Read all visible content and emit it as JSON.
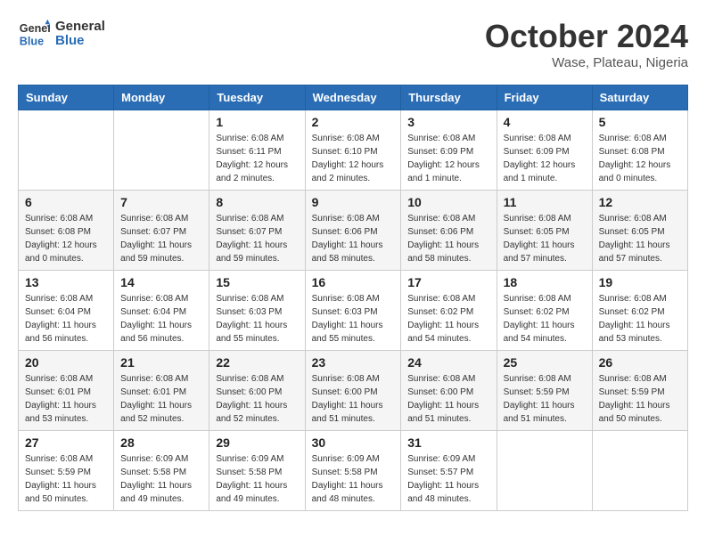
{
  "header": {
    "logo_line1": "General",
    "logo_line2": "Blue",
    "month": "October 2024",
    "location": "Wase, Plateau, Nigeria"
  },
  "weekdays": [
    "Sunday",
    "Monday",
    "Tuesday",
    "Wednesday",
    "Thursday",
    "Friday",
    "Saturday"
  ],
  "weeks": [
    [
      {
        "day": "",
        "detail": ""
      },
      {
        "day": "",
        "detail": ""
      },
      {
        "day": "1",
        "detail": "Sunrise: 6:08 AM\nSunset: 6:11 PM\nDaylight: 12 hours\nand 2 minutes."
      },
      {
        "day": "2",
        "detail": "Sunrise: 6:08 AM\nSunset: 6:10 PM\nDaylight: 12 hours\nand 2 minutes."
      },
      {
        "day": "3",
        "detail": "Sunrise: 6:08 AM\nSunset: 6:09 PM\nDaylight: 12 hours\nand 1 minute."
      },
      {
        "day": "4",
        "detail": "Sunrise: 6:08 AM\nSunset: 6:09 PM\nDaylight: 12 hours\nand 1 minute."
      },
      {
        "day": "5",
        "detail": "Sunrise: 6:08 AM\nSunset: 6:08 PM\nDaylight: 12 hours\nand 0 minutes."
      }
    ],
    [
      {
        "day": "6",
        "detail": "Sunrise: 6:08 AM\nSunset: 6:08 PM\nDaylight: 12 hours\nand 0 minutes."
      },
      {
        "day": "7",
        "detail": "Sunrise: 6:08 AM\nSunset: 6:07 PM\nDaylight: 11 hours\nand 59 minutes."
      },
      {
        "day": "8",
        "detail": "Sunrise: 6:08 AM\nSunset: 6:07 PM\nDaylight: 11 hours\nand 59 minutes."
      },
      {
        "day": "9",
        "detail": "Sunrise: 6:08 AM\nSunset: 6:06 PM\nDaylight: 11 hours\nand 58 minutes."
      },
      {
        "day": "10",
        "detail": "Sunrise: 6:08 AM\nSunset: 6:06 PM\nDaylight: 11 hours\nand 58 minutes."
      },
      {
        "day": "11",
        "detail": "Sunrise: 6:08 AM\nSunset: 6:05 PM\nDaylight: 11 hours\nand 57 minutes."
      },
      {
        "day": "12",
        "detail": "Sunrise: 6:08 AM\nSunset: 6:05 PM\nDaylight: 11 hours\nand 57 minutes."
      }
    ],
    [
      {
        "day": "13",
        "detail": "Sunrise: 6:08 AM\nSunset: 6:04 PM\nDaylight: 11 hours\nand 56 minutes."
      },
      {
        "day": "14",
        "detail": "Sunrise: 6:08 AM\nSunset: 6:04 PM\nDaylight: 11 hours\nand 56 minutes."
      },
      {
        "day": "15",
        "detail": "Sunrise: 6:08 AM\nSunset: 6:03 PM\nDaylight: 11 hours\nand 55 minutes."
      },
      {
        "day": "16",
        "detail": "Sunrise: 6:08 AM\nSunset: 6:03 PM\nDaylight: 11 hours\nand 55 minutes."
      },
      {
        "day": "17",
        "detail": "Sunrise: 6:08 AM\nSunset: 6:02 PM\nDaylight: 11 hours\nand 54 minutes."
      },
      {
        "day": "18",
        "detail": "Sunrise: 6:08 AM\nSunset: 6:02 PM\nDaylight: 11 hours\nand 54 minutes."
      },
      {
        "day": "19",
        "detail": "Sunrise: 6:08 AM\nSunset: 6:02 PM\nDaylight: 11 hours\nand 53 minutes."
      }
    ],
    [
      {
        "day": "20",
        "detail": "Sunrise: 6:08 AM\nSunset: 6:01 PM\nDaylight: 11 hours\nand 53 minutes."
      },
      {
        "day": "21",
        "detail": "Sunrise: 6:08 AM\nSunset: 6:01 PM\nDaylight: 11 hours\nand 52 minutes."
      },
      {
        "day": "22",
        "detail": "Sunrise: 6:08 AM\nSunset: 6:00 PM\nDaylight: 11 hours\nand 52 minutes."
      },
      {
        "day": "23",
        "detail": "Sunrise: 6:08 AM\nSunset: 6:00 PM\nDaylight: 11 hours\nand 51 minutes."
      },
      {
        "day": "24",
        "detail": "Sunrise: 6:08 AM\nSunset: 6:00 PM\nDaylight: 11 hours\nand 51 minutes."
      },
      {
        "day": "25",
        "detail": "Sunrise: 6:08 AM\nSunset: 5:59 PM\nDaylight: 11 hours\nand 51 minutes."
      },
      {
        "day": "26",
        "detail": "Sunrise: 6:08 AM\nSunset: 5:59 PM\nDaylight: 11 hours\nand 50 minutes."
      }
    ],
    [
      {
        "day": "27",
        "detail": "Sunrise: 6:08 AM\nSunset: 5:59 PM\nDaylight: 11 hours\nand 50 minutes."
      },
      {
        "day": "28",
        "detail": "Sunrise: 6:09 AM\nSunset: 5:58 PM\nDaylight: 11 hours\nand 49 minutes."
      },
      {
        "day": "29",
        "detail": "Sunrise: 6:09 AM\nSunset: 5:58 PM\nDaylight: 11 hours\nand 49 minutes."
      },
      {
        "day": "30",
        "detail": "Sunrise: 6:09 AM\nSunset: 5:58 PM\nDaylight: 11 hours\nand 48 minutes."
      },
      {
        "day": "31",
        "detail": "Sunrise: 6:09 AM\nSunset: 5:57 PM\nDaylight: 11 hours\nand 48 minutes."
      },
      {
        "day": "",
        "detail": ""
      },
      {
        "day": "",
        "detail": ""
      }
    ]
  ]
}
